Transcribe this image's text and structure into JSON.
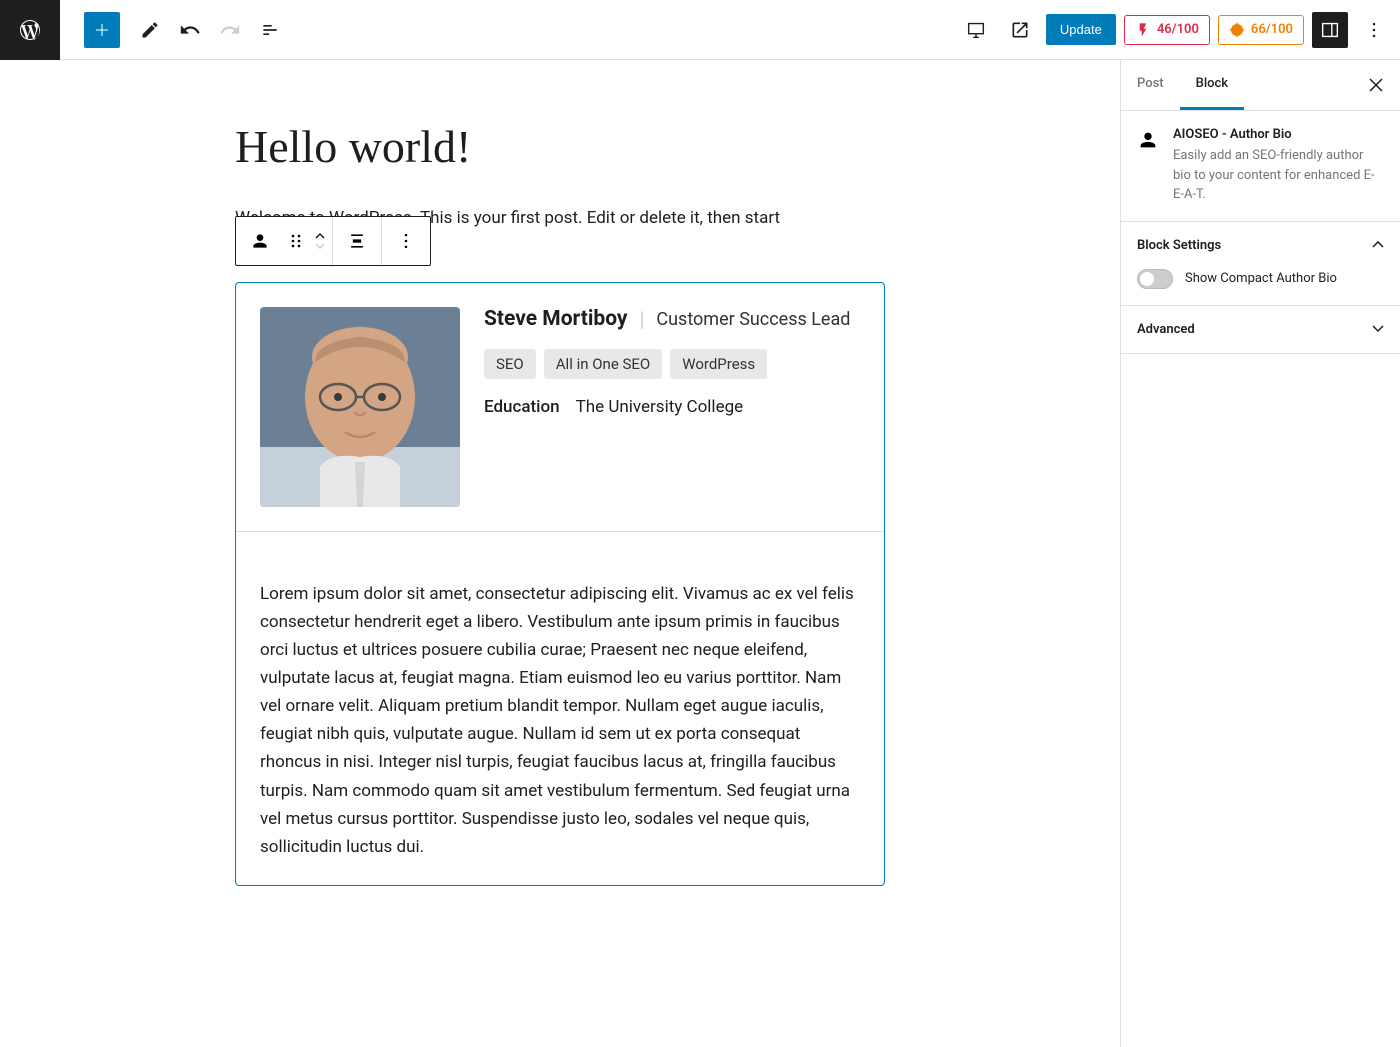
{
  "toolbar": {
    "update_label": "Update",
    "score_red": "46/100",
    "score_orange": "66/100"
  },
  "editor": {
    "title": "Hello world!",
    "intro_text": "Welcome to WordPress. This is your first post. Edit or delete it, then start"
  },
  "author_bio": {
    "name": "Steve Mortiboy",
    "role": "Customer Success Lead",
    "tags": [
      "SEO",
      "All in One SEO",
      "WordPress"
    ],
    "education_label": "Education",
    "education_value": "The University College",
    "bio_text": "Lorem ipsum dolor sit amet, consectetur adipiscing elit. Vivamus ac ex vel felis consectetur hendrerit eget a libero. Vestibulum ante ipsum primis in faucibus orci luctus et ultrices posuere cubilia curae; Praesent nec neque eleifend, vulputate lacus at, feugiat magna. Etiam euismod leo eu varius porttitor. Nam vel ornare velit. Aliquam pretium blandit tempor. Nullam eget augue iaculis, feugiat nibh quis, vulputate augue. Nullam id sem ut ex porta consequat rhoncus in nisi. Integer nisl turpis, feugiat faucibus lacus at, fringilla faucibus turpis. Nam commodo quam sit amet vestibulum fermentum. Sed feugiat urna vel metus cursus porttitor. Suspendisse justo leo, sodales vel neque quis, sollicitudin luctus dui."
  },
  "sidebar": {
    "tabs": {
      "post": "Post",
      "block": "Block"
    },
    "block_info": {
      "title": "AIOSEO - Author Bio",
      "desc": "Easily add an SEO-friendly author bio to your content for enhanced E-E-A-T."
    },
    "sections": {
      "block_settings": "Block Settings",
      "advanced": "Advanced"
    },
    "toggle_compact": "Show Compact Author Bio"
  }
}
